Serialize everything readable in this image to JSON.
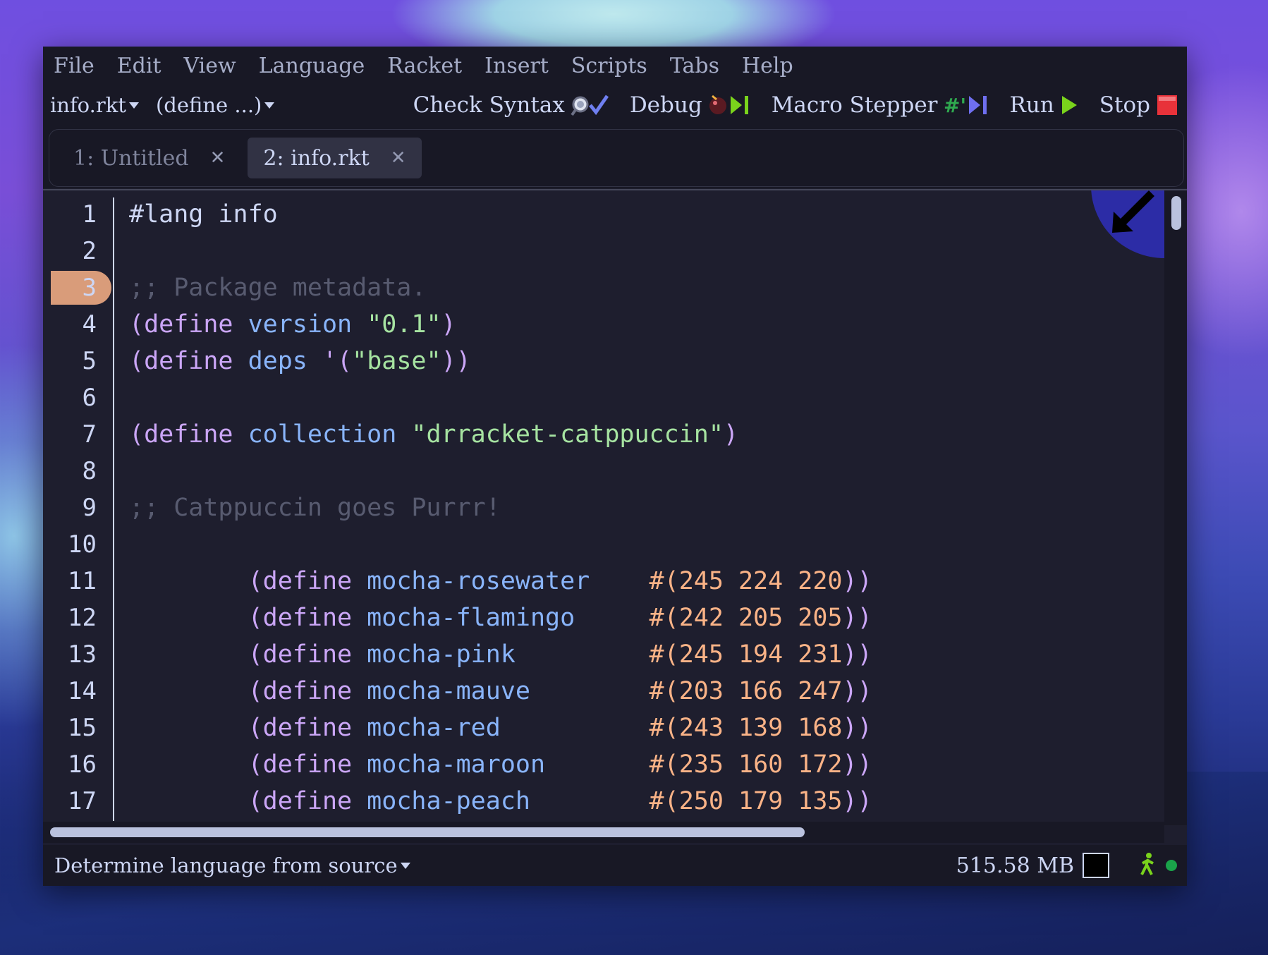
{
  "menubar": {
    "items": [
      "File",
      "Edit",
      "View",
      "Language",
      "Racket",
      "Insert",
      "Scripts",
      "Tabs",
      "Help"
    ]
  },
  "toolbar": {
    "file_dropdown": "info.rkt",
    "define_dropdown": "(define ...)",
    "check_syntax": "Check Syntax",
    "debug": "Debug",
    "macro_stepper": "Macro Stepper",
    "run": "Run",
    "stop": "Stop"
  },
  "tabs": [
    {
      "label": "1: Untitled",
      "active": false
    },
    {
      "label": "2: info.rkt",
      "active": true
    }
  ],
  "editor": {
    "breakpoint_line": 3,
    "lines": [
      {
        "n": "1",
        "tokens": [
          {
            "t": "#lang info",
            "c": "text"
          }
        ]
      },
      {
        "n": "2",
        "tokens": []
      },
      {
        "n": "3",
        "tokens": [
          {
            "t": ";; Package metadata.",
            "c": "comment"
          }
        ]
      },
      {
        "n": "4",
        "tokens": [
          {
            "t": "(",
            "c": "paren"
          },
          {
            "t": "define",
            "c": "kw"
          },
          {
            "t": " ",
            "c": "text"
          },
          {
            "t": "version",
            "c": "id"
          },
          {
            "t": " ",
            "c": "text"
          },
          {
            "t": "\"0.1\"",
            "c": "str"
          },
          {
            "t": ")",
            "c": "paren"
          }
        ]
      },
      {
        "n": "5",
        "tokens": [
          {
            "t": "(",
            "c": "paren"
          },
          {
            "t": "define",
            "c": "kw"
          },
          {
            "t": " ",
            "c": "text"
          },
          {
            "t": "deps",
            "c": "id"
          },
          {
            "t": " ",
            "c": "text"
          },
          {
            "t": "'(",
            "c": "paren"
          },
          {
            "t": "\"base\"",
            "c": "str"
          },
          {
            "t": "))",
            "c": "paren"
          }
        ]
      },
      {
        "n": "6",
        "tokens": []
      },
      {
        "n": "7",
        "tokens": [
          {
            "t": "(",
            "c": "paren"
          },
          {
            "t": "define",
            "c": "kw"
          },
          {
            "t": " ",
            "c": "text"
          },
          {
            "t": "collection",
            "c": "id"
          },
          {
            "t": " ",
            "c": "text"
          },
          {
            "t": "\"drracket-catppuccin\"",
            "c": "str"
          },
          {
            "t": ")",
            "c": "paren"
          }
        ]
      },
      {
        "n": "8",
        "tokens": []
      },
      {
        "n": "9",
        "tokens": [
          {
            "t": ";; Catppuccin goes Purrr!",
            "c": "comment"
          }
        ]
      },
      {
        "n": "10",
        "tokens": []
      },
      {
        "n": "11",
        "tokens": [
          {
            "t": "        (",
            "c": "paren"
          },
          {
            "t": "define",
            "c": "kw"
          },
          {
            "t": " ",
            "c": "text"
          },
          {
            "t": "mocha-rosewater",
            "c": "id"
          },
          {
            "t": "    ",
            "c": "text"
          },
          {
            "t": "#(",
            "c": "num"
          },
          {
            "t": "245 224 220",
            "c": "num"
          },
          {
            "t": "))",
            "c": "paren"
          }
        ]
      },
      {
        "n": "12",
        "tokens": [
          {
            "t": "        (",
            "c": "paren"
          },
          {
            "t": "define",
            "c": "kw"
          },
          {
            "t": " ",
            "c": "text"
          },
          {
            "t": "mocha-flamingo",
            "c": "id"
          },
          {
            "t": "     ",
            "c": "text"
          },
          {
            "t": "#(",
            "c": "num"
          },
          {
            "t": "242 205 205",
            "c": "num"
          },
          {
            "t": "))",
            "c": "paren"
          }
        ]
      },
      {
        "n": "13",
        "tokens": [
          {
            "t": "        (",
            "c": "paren"
          },
          {
            "t": "define",
            "c": "kw"
          },
          {
            "t": " ",
            "c": "text"
          },
          {
            "t": "mocha-pink",
            "c": "id"
          },
          {
            "t": "         ",
            "c": "text"
          },
          {
            "t": "#(",
            "c": "num"
          },
          {
            "t": "245 194 231",
            "c": "num"
          },
          {
            "t": "))",
            "c": "paren"
          }
        ]
      },
      {
        "n": "14",
        "tokens": [
          {
            "t": "        (",
            "c": "paren"
          },
          {
            "t": "define",
            "c": "kw"
          },
          {
            "t": " ",
            "c": "text"
          },
          {
            "t": "mocha-mauve",
            "c": "id"
          },
          {
            "t": "        ",
            "c": "text"
          },
          {
            "t": "#(",
            "c": "num"
          },
          {
            "t": "203 166 247",
            "c": "num"
          },
          {
            "t": "))",
            "c": "paren"
          }
        ]
      },
      {
        "n": "15",
        "tokens": [
          {
            "t": "        (",
            "c": "paren"
          },
          {
            "t": "define",
            "c": "kw"
          },
          {
            "t": " ",
            "c": "text"
          },
          {
            "t": "mocha-red",
            "c": "id"
          },
          {
            "t": "          ",
            "c": "text"
          },
          {
            "t": "#(",
            "c": "num"
          },
          {
            "t": "243 139 168",
            "c": "num"
          },
          {
            "t": "))",
            "c": "paren"
          }
        ]
      },
      {
        "n": "16",
        "tokens": [
          {
            "t": "        (",
            "c": "paren"
          },
          {
            "t": "define",
            "c": "kw"
          },
          {
            "t": " ",
            "c": "text"
          },
          {
            "t": "mocha-maroon",
            "c": "id"
          },
          {
            "t": "       ",
            "c": "text"
          },
          {
            "t": "#(",
            "c": "num"
          },
          {
            "t": "235 160 172",
            "c": "num"
          },
          {
            "t": "))",
            "c": "paren"
          }
        ]
      },
      {
        "n": "17",
        "tokens": [
          {
            "t": "        (",
            "c": "paren"
          },
          {
            "t": "define",
            "c": "kw"
          },
          {
            "t": " ",
            "c": "text"
          },
          {
            "t": "mocha-peach",
            "c": "id"
          },
          {
            "t": "        ",
            "c": "text"
          },
          {
            "t": "#(",
            "c": "num"
          },
          {
            "t": "250 179 135",
            "c": "num"
          },
          {
            "t": "))",
            "c": "paren"
          }
        ]
      }
    ]
  },
  "status": {
    "language": "Determine language from source",
    "memory": "515.58 MB"
  },
  "colors": {
    "base": "#1e1e2e",
    "mantle": "#181825",
    "text": "#cdd6f4",
    "mauve": "#cba6f7",
    "blue": "#89b4fa",
    "green": "#a6e3a1",
    "peach": "#fab387",
    "comment": "#585b70"
  },
  "icons": [
    "magnifier-check-icon",
    "debug-bug-icon",
    "macro-stepper-icon",
    "run-arrow-icon",
    "stop-square-icon",
    "walker-icon",
    "status-dot-icon"
  ]
}
